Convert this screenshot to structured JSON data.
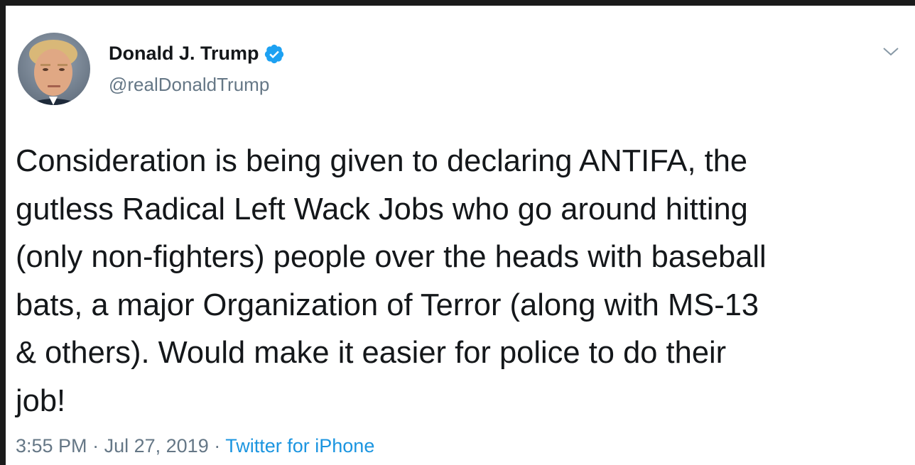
{
  "tweet": {
    "author": {
      "display_name": "Donald J. Trump",
      "handle": "@realDonaldTrump",
      "verified": true,
      "avatar_icon": "profile-photo"
    },
    "text": "Consideration is being given to declaring ANTIFA, the\ngutless Radical Left Wack Jobs who go around hitting\n(only non-fighters) people over the heads with baseball\nbats, a major Organization of Terror (along with MS-13\n& others). Would make it easier for police to do their\njob!",
    "time": "3:55 PM",
    "separator": "·",
    "date": "Jul 27, 2019",
    "source": "Twitter for iPhone",
    "menu_icon": "chevron-down-icon"
  },
  "colors": {
    "text": "#14171a",
    "secondary": "#657786",
    "link": "#1b95e0",
    "verified": "#1da1f2",
    "frame": "#1a1a1a"
  }
}
